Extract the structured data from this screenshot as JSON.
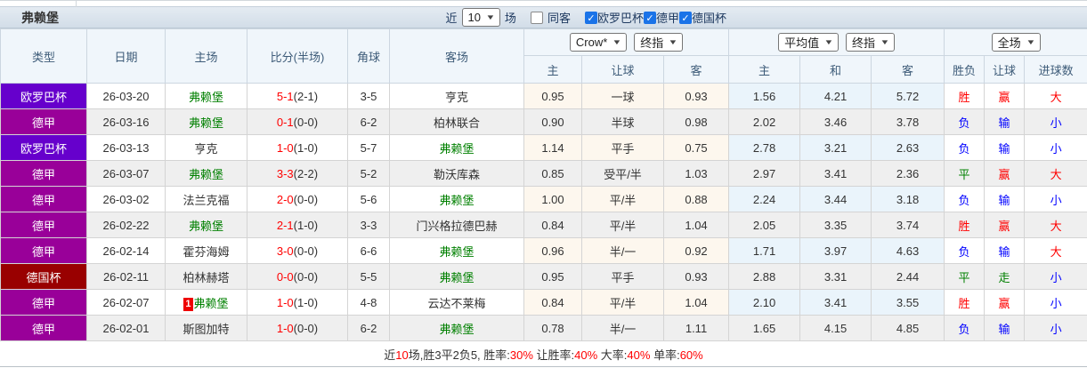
{
  "title": "弗赖堡",
  "toolbar": {
    "recent_label": "近",
    "recent_value": "10",
    "matches_label": "场",
    "same_away_label": "同客",
    "same_away_checked": false,
    "filters": [
      {
        "label": "欧罗巴杯",
        "checked": true
      },
      {
        "label": "德甲",
        "checked": true
      },
      {
        "label": "德国杯",
        "checked": true
      }
    ]
  },
  "header": {
    "cols": [
      "类型",
      "日期",
      "主场",
      "比分(半场)",
      "角球",
      "客场"
    ],
    "asia": {
      "company": "Crow*",
      "mode": "终指",
      "sub": [
        "主",
        "让球",
        "客"
      ]
    },
    "euro": {
      "company": "平均值",
      "mode": "终指",
      "sub": [
        "主",
        "和",
        "客"
      ]
    },
    "result": {
      "scope": "全场",
      "sub": [
        "胜负",
        "让球",
        "进球数"
      ]
    }
  },
  "colors": {
    "red": "#ff0000",
    "blue": "#0000ff",
    "green": "#008000",
    "team_green": "#008000",
    "checkbox_blue": "#1a73e8"
  },
  "type_colors": {
    "欧罗巴杯": "#6600cc",
    "德甲": "#990099",
    "德国杯": "#990000"
  },
  "rows": [
    {
      "type": "欧罗巴杯",
      "date": "26-03-20",
      "home": "弗赖堡",
      "home_green": true,
      "score": "5-1",
      "half": "(2-1)",
      "corner": "3-5",
      "away": "亨克",
      "away_green": false,
      "asia": [
        "0.95",
        "一球",
        "0.93"
      ],
      "euro": [
        "1.56",
        "4.21",
        "5.72"
      ],
      "result": [
        [
          "胜",
          "red"
        ],
        [
          "赢",
          "red"
        ],
        [
          "大",
          "red"
        ]
      ]
    },
    {
      "type": "德甲",
      "date": "26-03-16",
      "home": "弗赖堡",
      "home_green": true,
      "score": "0-1",
      "half": "(0-0)",
      "corner": "6-2",
      "away": "柏林联合",
      "away_green": false,
      "asia": [
        "0.90",
        "半球",
        "0.98"
      ],
      "euro": [
        "2.02",
        "3.46",
        "3.78"
      ],
      "result": [
        [
          "负",
          "blue"
        ],
        [
          "输",
          "blue"
        ],
        [
          "小",
          "blue"
        ]
      ]
    },
    {
      "type": "欧罗巴杯",
      "date": "26-03-13",
      "home": "亨克",
      "home_green": false,
      "score": "1-0",
      "half": "(1-0)",
      "corner": "5-7",
      "away": "弗赖堡",
      "away_green": true,
      "asia": [
        "1.14",
        "平手",
        "0.75"
      ],
      "euro": [
        "2.78",
        "3.21",
        "2.63"
      ],
      "result": [
        [
          "负",
          "blue"
        ],
        [
          "输",
          "blue"
        ],
        [
          "小",
          "blue"
        ]
      ]
    },
    {
      "type": "德甲",
      "date": "26-03-07",
      "home": "弗赖堡",
      "home_green": true,
      "score": "3-3",
      "half": "(2-2)",
      "corner": "5-2",
      "away": "勒沃库森",
      "away_green": false,
      "asia": [
        "0.85",
        "受平/半",
        "1.03"
      ],
      "euro": [
        "2.97",
        "3.41",
        "2.36"
      ],
      "result": [
        [
          "平",
          "green"
        ],
        [
          "赢",
          "red"
        ],
        [
          "大",
          "red"
        ]
      ]
    },
    {
      "type": "德甲",
      "date": "26-03-02",
      "home": "法兰克福",
      "home_green": false,
      "score": "2-0",
      "half": "(0-0)",
      "corner": "5-6",
      "away": "弗赖堡",
      "away_green": true,
      "asia": [
        "1.00",
        "平/半",
        "0.88"
      ],
      "euro": [
        "2.24",
        "3.44",
        "3.18"
      ],
      "result": [
        [
          "负",
          "blue"
        ],
        [
          "输",
          "blue"
        ],
        [
          "小",
          "blue"
        ]
      ]
    },
    {
      "type": "德甲",
      "date": "26-02-22",
      "home": "弗赖堡",
      "home_green": true,
      "score": "2-1",
      "half": "(1-0)",
      "corner": "3-3",
      "away": "门兴格拉德巴赫",
      "away_green": false,
      "asia": [
        "0.84",
        "平/半",
        "1.04"
      ],
      "euro": [
        "2.05",
        "3.35",
        "3.74"
      ],
      "result": [
        [
          "胜",
          "red"
        ],
        [
          "赢",
          "red"
        ],
        [
          "大",
          "red"
        ]
      ]
    },
    {
      "type": "德甲",
      "date": "26-02-14",
      "home": "霍芬海姆",
      "home_green": false,
      "score": "3-0",
      "half": "(0-0)",
      "corner": "6-6",
      "away": "弗赖堡",
      "away_green": true,
      "asia": [
        "0.96",
        "半/一",
        "0.92"
      ],
      "euro": [
        "1.71",
        "3.97",
        "4.63"
      ],
      "result": [
        [
          "负",
          "blue"
        ],
        [
          "输",
          "blue"
        ],
        [
          "大",
          "red"
        ]
      ]
    },
    {
      "type": "德国杯",
      "date": "26-02-11",
      "home": "柏林赫塔",
      "home_green": false,
      "score": "0-0",
      "half": "(0-0)",
      "corner": "5-5",
      "away": "弗赖堡",
      "away_green": true,
      "asia": [
        "0.95",
        "平手",
        "0.93"
      ],
      "euro": [
        "2.88",
        "3.31",
        "2.44"
      ],
      "result": [
        [
          "平",
          "green"
        ],
        [
          "走",
          "green"
        ],
        [
          "小",
          "blue"
        ]
      ]
    },
    {
      "type": "德甲",
      "date": "26-02-07",
      "home": "弗赖堡",
      "home_green": true,
      "badge": "1",
      "score": "1-0",
      "half": "(1-0)",
      "corner": "4-8",
      "away": "云达不莱梅",
      "away_green": false,
      "asia": [
        "0.84",
        "平/半",
        "1.04"
      ],
      "euro": [
        "2.10",
        "3.41",
        "3.55"
      ],
      "result": [
        [
          "胜",
          "red"
        ],
        [
          "赢",
          "red"
        ],
        [
          "小",
          "blue"
        ]
      ]
    },
    {
      "type": "德甲",
      "date": "26-02-01",
      "home": "斯图加特",
      "home_green": false,
      "score": "1-0",
      "half": "(0-0)",
      "corner": "6-2",
      "away": "弗赖堡",
      "away_green": true,
      "asia": [
        "0.78",
        "半/一",
        "1.11"
      ],
      "euro": [
        "1.65",
        "4.15",
        "4.85"
      ],
      "result": [
        [
          "负",
          "blue"
        ],
        [
          "输",
          "blue"
        ],
        [
          "小",
          "blue"
        ]
      ]
    }
  ],
  "footer": {
    "segments": [
      [
        "近",
        "dark"
      ],
      [
        "10",
        "red"
      ],
      [
        "场,胜3平2负5, 胜率:",
        "dark"
      ],
      [
        "30%",
        "red"
      ],
      [
        " 让胜率:",
        "dark"
      ],
      [
        "40%",
        "red"
      ],
      [
        " 大率:",
        "dark"
      ],
      [
        "40%",
        "red"
      ],
      [
        " 单率:",
        "dark"
      ],
      [
        "60%",
        "red"
      ]
    ]
  }
}
